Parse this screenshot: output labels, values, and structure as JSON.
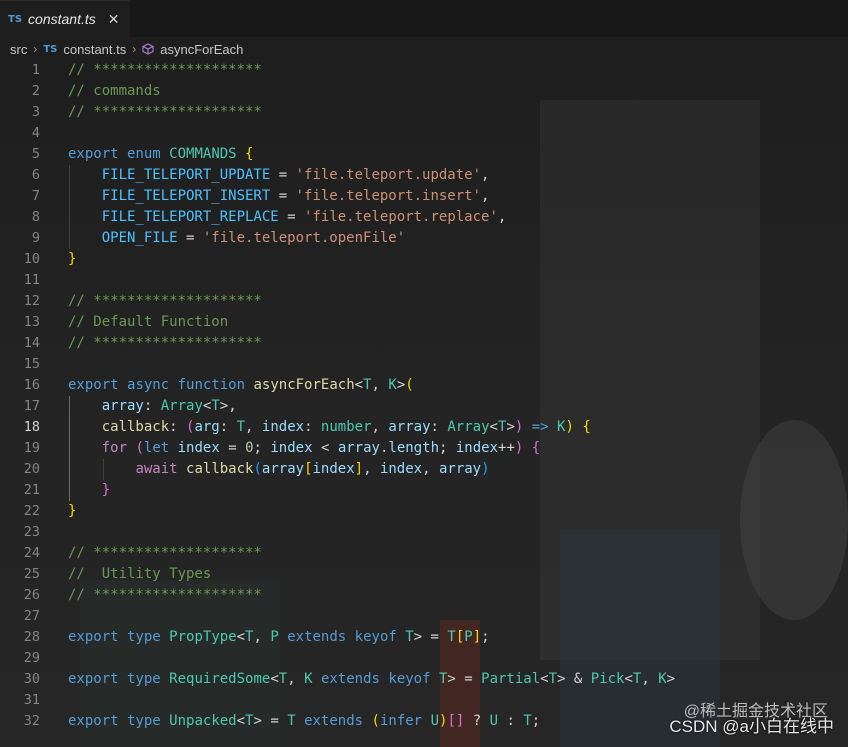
{
  "tab": {
    "badge": "TS",
    "title": "constant.ts",
    "close": "✕"
  },
  "breadcrumb": {
    "folder": "src",
    "file_badge": "TS",
    "file": "constant.ts",
    "symbol": "asyncForEach"
  },
  "watermark": {
    "top": "@稀土掘金技术社区",
    "bottom": "CSDN @a小白在线中"
  },
  "active_line": 18,
  "lines": [
    {
      "n": "1",
      "tokens": [
        [
          "c-com",
          "// ********************"
        ]
      ]
    },
    {
      "n": "2",
      "tokens": [
        [
          "c-com",
          "// commands"
        ]
      ]
    },
    {
      "n": "3",
      "tokens": [
        [
          "c-com",
          "// ********************"
        ]
      ]
    },
    {
      "n": "4",
      "tokens": []
    },
    {
      "n": "5",
      "tokens": [
        [
          "c-kw",
          "export"
        ],
        [
          "c-op",
          " "
        ],
        [
          "c-kw",
          "enum"
        ],
        [
          "c-op",
          " "
        ],
        [
          "c-ty",
          "COMMANDS"
        ],
        [
          "c-op",
          " "
        ],
        [
          "c-br1",
          "{"
        ]
      ]
    },
    {
      "n": "6",
      "tokens": [
        [
          "c-op",
          "    "
        ],
        [
          "c-enum",
          "FILE_TELEPORT_UPDATE"
        ],
        [
          "c-op",
          " = "
        ],
        [
          "c-str",
          "'file.teleport.update'"
        ],
        [
          "c-op",
          ","
        ]
      ]
    },
    {
      "n": "7",
      "tokens": [
        [
          "c-op",
          "    "
        ],
        [
          "c-enum",
          "FILE_TELEPORT_INSERT"
        ],
        [
          "c-op",
          " = "
        ],
        [
          "c-str",
          "'file.teleport.insert'"
        ],
        [
          "c-op",
          ","
        ]
      ]
    },
    {
      "n": "8",
      "tokens": [
        [
          "c-op",
          "    "
        ],
        [
          "c-enum",
          "FILE_TELEPORT_REPLACE"
        ],
        [
          "c-op",
          " = "
        ],
        [
          "c-str",
          "'file.teleport.replace'"
        ],
        [
          "c-op",
          ","
        ]
      ]
    },
    {
      "n": "9",
      "tokens": [
        [
          "c-op",
          "    "
        ],
        [
          "c-enum",
          "OPEN_FILE"
        ],
        [
          "c-op",
          " = "
        ],
        [
          "c-str",
          "'file.teleport.openFile'"
        ]
      ]
    },
    {
      "n": "10",
      "tokens": [
        [
          "c-br1",
          "}"
        ]
      ]
    },
    {
      "n": "11",
      "tokens": []
    },
    {
      "n": "12",
      "tokens": [
        [
          "c-com",
          "// ********************"
        ]
      ]
    },
    {
      "n": "13",
      "tokens": [
        [
          "c-com",
          "// Default Function"
        ]
      ]
    },
    {
      "n": "14",
      "tokens": [
        [
          "c-com",
          "// ********************"
        ]
      ]
    },
    {
      "n": "15",
      "tokens": []
    },
    {
      "n": "16",
      "tokens": [
        [
          "c-kw",
          "export"
        ],
        [
          "c-op",
          " "
        ],
        [
          "c-kw",
          "async"
        ],
        [
          "c-op",
          " "
        ],
        [
          "c-kw",
          "function"
        ],
        [
          "c-op",
          " "
        ],
        [
          "c-fn",
          "asyncForEach"
        ],
        [
          "c-op",
          "<"
        ],
        [
          "c-ty",
          "T"
        ],
        [
          "c-op",
          ", "
        ],
        [
          "c-ty",
          "K"
        ],
        [
          "c-op",
          ">"
        ],
        [
          "c-br1",
          "("
        ]
      ]
    },
    {
      "n": "17",
      "tokens": [
        [
          "c-op",
          "    "
        ],
        [
          "c-var",
          "array"
        ],
        [
          "c-op",
          ": "
        ],
        [
          "c-ty",
          "Array"
        ],
        [
          "c-op",
          "<"
        ],
        [
          "c-ty",
          "T"
        ],
        [
          "c-op",
          ">,"
        ]
      ]
    },
    {
      "n": "18",
      "tokens": [
        [
          "c-op",
          "    "
        ],
        [
          "c-fn",
          "callback"
        ],
        [
          "c-op",
          ": "
        ],
        [
          "c-br2",
          "("
        ],
        [
          "c-var",
          "arg"
        ],
        [
          "c-op",
          ": "
        ],
        [
          "c-ty",
          "T"
        ],
        [
          "c-op",
          ", "
        ],
        [
          "c-var",
          "index"
        ],
        [
          "c-op",
          ": "
        ],
        [
          "c-ty",
          "number"
        ],
        [
          "c-op",
          ", "
        ],
        [
          "c-var",
          "array"
        ],
        [
          "c-op",
          ": "
        ],
        [
          "c-ty",
          "Array"
        ],
        [
          "c-op",
          "<"
        ],
        [
          "c-ty",
          "T"
        ],
        [
          "c-op",
          ">"
        ],
        [
          "c-br2",
          ")"
        ],
        [
          "c-op",
          " "
        ],
        [
          "c-kw",
          "=>"
        ],
        [
          "c-op",
          " "
        ],
        [
          "c-ty",
          "K"
        ],
        [
          "c-br1",
          ")"
        ],
        [
          "c-op",
          " "
        ],
        [
          "c-br1",
          "{"
        ]
      ]
    },
    {
      "n": "19",
      "tokens": [
        [
          "c-op",
          "    "
        ],
        [
          "c-fl",
          "for"
        ],
        [
          "c-op",
          " "
        ],
        [
          "c-br2",
          "("
        ],
        [
          "c-kw",
          "let"
        ],
        [
          "c-op",
          " "
        ],
        [
          "c-var",
          "index"
        ],
        [
          "c-op",
          " = "
        ],
        [
          "c-num",
          "0"
        ],
        [
          "c-op",
          "; "
        ],
        [
          "c-var",
          "index"
        ],
        [
          "c-op",
          " < "
        ],
        [
          "c-var",
          "array"
        ],
        [
          "c-op",
          "."
        ],
        [
          "c-var",
          "length"
        ],
        [
          "c-op",
          "; "
        ],
        [
          "c-var",
          "index"
        ],
        [
          "c-op",
          "++"
        ],
        [
          "c-br2",
          ")"
        ],
        [
          "c-op",
          " "
        ],
        [
          "c-br2",
          "{"
        ]
      ]
    },
    {
      "n": "20",
      "tokens": [
        [
          "c-op",
          "        "
        ],
        [
          "c-fl",
          "await"
        ],
        [
          "c-op",
          " "
        ],
        [
          "c-fn",
          "callback"
        ],
        [
          "c-br3",
          "("
        ],
        [
          "c-var",
          "array"
        ],
        [
          "c-br1",
          "["
        ],
        [
          "c-var",
          "index"
        ],
        [
          "c-br1",
          "]"
        ],
        [
          "c-op",
          ", "
        ],
        [
          "c-var",
          "index"
        ],
        [
          "c-op",
          ", "
        ],
        [
          "c-var",
          "array"
        ],
        [
          "c-br3",
          ")"
        ]
      ]
    },
    {
      "n": "21",
      "tokens": [
        [
          "c-op",
          "    "
        ],
        [
          "c-br2",
          "}"
        ]
      ]
    },
    {
      "n": "22",
      "tokens": [
        [
          "c-br1",
          "}"
        ]
      ]
    },
    {
      "n": "23",
      "tokens": []
    },
    {
      "n": "24",
      "tokens": [
        [
          "c-com",
          "// ********************"
        ]
      ]
    },
    {
      "n": "25",
      "tokens": [
        [
          "c-com",
          "//  Utility Types"
        ]
      ]
    },
    {
      "n": "26",
      "tokens": [
        [
          "c-com",
          "// ********************"
        ]
      ]
    },
    {
      "n": "27",
      "tokens": []
    },
    {
      "n": "28",
      "tokens": [
        [
          "c-kw",
          "export"
        ],
        [
          "c-op",
          " "
        ],
        [
          "c-kw",
          "type"
        ],
        [
          "c-op",
          " "
        ],
        [
          "c-ty",
          "PropType"
        ],
        [
          "c-op",
          "<"
        ],
        [
          "c-ty",
          "T"
        ],
        [
          "c-op",
          ", "
        ],
        [
          "c-ty",
          "P"
        ],
        [
          "c-op",
          " "
        ],
        [
          "c-kw",
          "extends"
        ],
        [
          "c-op",
          " "
        ],
        [
          "c-kw",
          "keyof"
        ],
        [
          "c-op",
          " "
        ],
        [
          "c-ty",
          "T"
        ],
        [
          "c-op",
          "> = "
        ],
        [
          "c-ty",
          "T"
        ],
        [
          "c-br1",
          "["
        ],
        [
          "c-ty",
          "P"
        ],
        [
          "c-br1",
          "]"
        ],
        [
          "c-op",
          ";"
        ]
      ]
    },
    {
      "n": "29",
      "tokens": []
    },
    {
      "n": "30",
      "tokens": [
        [
          "c-kw",
          "export"
        ],
        [
          "c-op",
          " "
        ],
        [
          "c-kw",
          "type"
        ],
        [
          "c-op",
          " "
        ],
        [
          "c-ty",
          "RequiredSome"
        ],
        [
          "c-op",
          "<"
        ],
        [
          "c-ty",
          "T"
        ],
        [
          "c-op",
          ", "
        ],
        [
          "c-ty",
          "K"
        ],
        [
          "c-op",
          " "
        ],
        [
          "c-kw",
          "extends"
        ],
        [
          "c-op",
          " "
        ],
        [
          "c-kw",
          "keyof"
        ],
        [
          "c-op",
          " "
        ],
        [
          "c-ty",
          "T"
        ],
        [
          "c-op",
          "> = "
        ],
        [
          "c-ty",
          "Partial"
        ],
        [
          "c-op",
          "<"
        ],
        [
          "c-ty",
          "T"
        ],
        [
          "c-op",
          "> & "
        ],
        [
          "c-ty",
          "Pick"
        ],
        [
          "c-op",
          "<"
        ],
        [
          "c-ty",
          "T"
        ],
        [
          "c-op",
          ", "
        ],
        [
          "c-ty",
          "K"
        ],
        [
          "c-op",
          ">"
        ]
      ]
    },
    {
      "n": "31",
      "tokens": []
    },
    {
      "n": "32",
      "tokens": [
        [
          "c-kw",
          "export"
        ],
        [
          "c-op",
          " "
        ],
        [
          "c-kw",
          "type"
        ],
        [
          "c-op",
          " "
        ],
        [
          "c-ty",
          "Unpacked"
        ],
        [
          "c-op",
          "<"
        ],
        [
          "c-ty",
          "T"
        ],
        [
          "c-op",
          "> = "
        ],
        [
          "c-ty",
          "T"
        ],
        [
          "c-op",
          " "
        ],
        [
          "c-kw",
          "extends"
        ],
        [
          "c-op",
          " "
        ],
        [
          "c-br1",
          "("
        ],
        [
          "c-kw",
          "infer"
        ],
        [
          "c-op",
          " "
        ],
        [
          "c-ty",
          "U"
        ],
        [
          "c-br1",
          ")"
        ],
        [
          "c-br2",
          "[]"
        ],
        [
          "c-op",
          " ? "
        ],
        [
          "c-ty",
          "U"
        ],
        [
          "c-op",
          " : "
        ],
        [
          "c-ty",
          "T"
        ],
        [
          "c-op",
          ";"
        ]
      ]
    }
  ]
}
